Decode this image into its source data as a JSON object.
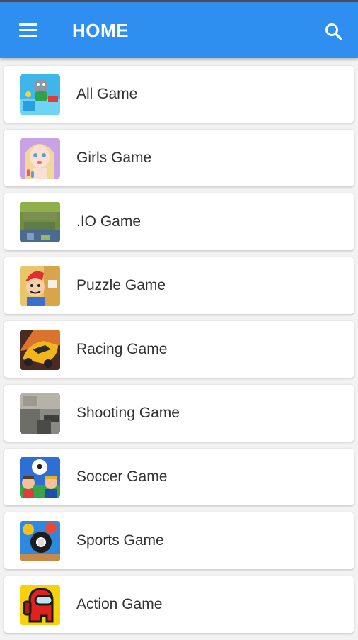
{
  "appbar": {
    "title": "HOME",
    "menu_icon": "hamburger-menu-icon",
    "search_icon": "search-icon",
    "color": "#2f8ff0"
  },
  "categories": [
    {
      "label": "All Game",
      "icon": "all-game-thumbnail-icon"
    },
    {
      "label": "Girls Game",
      "icon": "girls-game-thumbnail-icon"
    },
    {
      "label": ".IO Game",
      "icon": "io-game-thumbnail-icon"
    },
    {
      "label": "Puzzle Game",
      "icon": "puzzle-game-thumbnail-icon"
    },
    {
      "label": "Racing Game",
      "icon": "racing-game-thumbnail-icon"
    },
    {
      "label": "Shooting Game",
      "icon": "shooting-game-thumbnail-icon"
    },
    {
      "label": "Soccer Game",
      "icon": "soccer-game-thumbnail-icon"
    },
    {
      "label": "Sports Game",
      "icon": "sports-game-thumbnail-icon"
    },
    {
      "label": "Action Game",
      "icon": "action-game-thumbnail-icon"
    }
  ]
}
